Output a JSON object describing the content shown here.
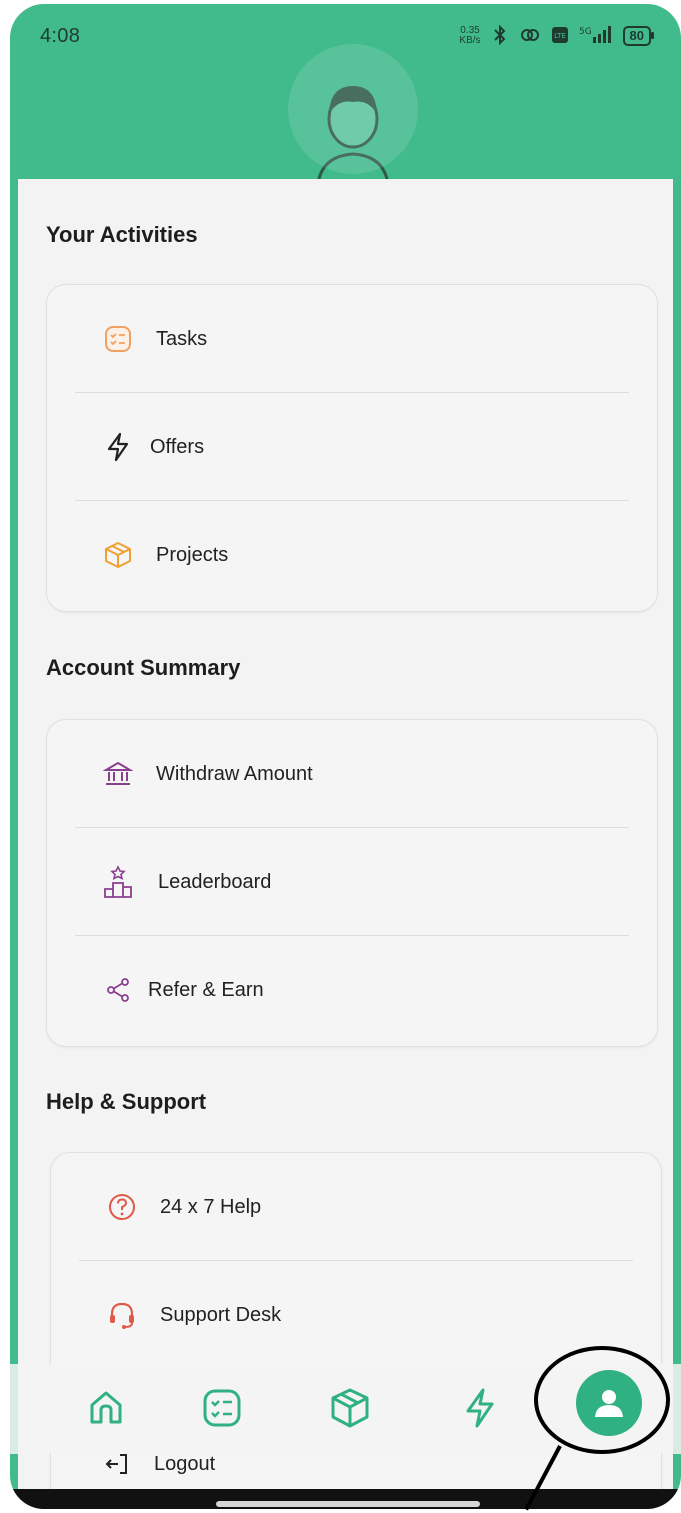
{
  "status_bar": {
    "time": "4:08",
    "speed": "0.35\nKB/s",
    "network": "5G",
    "battery": "80"
  },
  "sections": {
    "activities": {
      "title": "Your Activities",
      "items": [
        {
          "label": "Tasks",
          "icon": "tasks-icon"
        },
        {
          "label": "Offers",
          "icon": "lightning-icon"
        },
        {
          "label": "Projects",
          "icon": "box-icon"
        }
      ]
    },
    "account": {
      "title": "Account Summary",
      "items": [
        {
          "label": "Withdraw Amount",
          "icon": "bank-icon"
        },
        {
          "label": "Leaderboard",
          "icon": "podium-icon"
        },
        {
          "label": "Refer & Earn",
          "icon": "share-icon"
        }
      ]
    },
    "help": {
      "title": "Help & Support",
      "items": [
        {
          "label": "24 x 7 Help",
          "icon": "question-icon"
        },
        {
          "label": "Support Desk",
          "icon": "headset-icon"
        }
      ]
    }
  },
  "logout": {
    "label": "Logout",
    "icon": "logout-icon"
  },
  "bottom_nav": [
    "home-icon",
    "tasks-icon",
    "box-icon",
    "lightning-icon",
    "profile-icon"
  ],
  "colors": {
    "brand_green": "#41bb8c",
    "active_nav": "#30b181",
    "tasks_orange": "#f0a060",
    "bank_purple": "#8a3f8f",
    "help_red": "#e05a4a"
  }
}
